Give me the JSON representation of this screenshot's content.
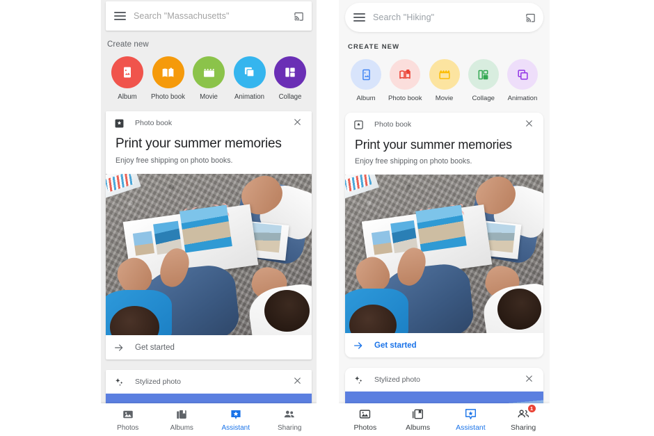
{
  "panels": {
    "old": {
      "search": {
        "placeholder": "Search \"Massachusetts\"",
        "menu_icon": "hamburger-menu-icon",
        "cast_icon": "cast-icon"
      },
      "create_new": {
        "title": "Create new",
        "items": [
          {
            "label": "Album",
            "icon": "album-icon",
            "circle": "#F0544C",
            "glyph": "#ffffff"
          },
          {
            "label": "Photo book",
            "icon": "photo-book-icon",
            "circle": "#F59A0B",
            "glyph": "#ffffff"
          },
          {
            "label": "Movie",
            "icon": "movie-icon",
            "circle": "#8BC34A",
            "glyph": "#ffffff"
          },
          {
            "label": "Animation",
            "icon": "animation-icon",
            "circle": "#35B5EE",
            "glyph": "#ffffff"
          },
          {
            "label": "Collage",
            "icon": "collage-icon",
            "circle": "#6A2FB5",
            "glyph": "#ffffff"
          }
        ]
      },
      "cards": [
        {
          "source_icon": "assistant-card-icon",
          "source_label": "Photo book",
          "close_icon": "close-icon",
          "title": "Print your summer memories",
          "subtitle": "Enjoy free shipping on photo books.",
          "cta_icon": "arrow-right-icon",
          "cta_label": "Get started"
        },
        {
          "source_icon": "stylized-photo-icon",
          "source_label": "Stylized photo",
          "close_icon": "close-icon"
        }
      ],
      "bottom_nav": [
        {
          "label": "Photos",
          "icon": "photos-icon",
          "active": false,
          "badge": ""
        },
        {
          "label": "Albums",
          "icon": "albums-icon",
          "active": false,
          "badge": ""
        },
        {
          "label": "Assistant",
          "icon": "assistant-icon",
          "active": true,
          "badge": ""
        },
        {
          "label": "Sharing",
          "icon": "sharing-icon",
          "active": false,
          "badge": ""
        }
      ]
    },
    "new": {
      "search": {
        "placeholder": "Search \"Hiking\"",
        "menu_icon": "hamburger-menu-icon",
        "cast_icon": "cast-icon"
      },
      "create_new": {
        "title": "CREATE NEW",
        "items": [
          {
            "label": "Album",
            "icon": "album-icon",
            "circle": "#D8E4FB",
            "glyph": "#4285F4"
          },
          {
            "label": "Photo book",
            "icon": "photo-book-icon",
            "circle": "#FBDEDC",
            "glyph": "#EA4335"
          },
          {
            "label": "Movie",
            "icon": "movie-icon",
            "circle": "#FCE4A0",
            "glyph": "#FBBC04"
          },
          {
            "label": "Collage",
            "icon": "collage-icon",
            "circle": "#D8EDDF",
            "glyph": "#34A853"
          },
          {
            "label": "Animation",
            "icon": "animation-icon",
            "circle": "#EEDEFA",
            "glyph": "#9334E6"
          }
        ]
      },
      "cards": [
        {
          "source_icon": "assistant-card-icon",
          "source_label": "Photo book",
          "close_icon": "close-icon",
          "title": "Print your summer memories",
          "subtitle": "Enjoy free shipping on photo books.",
          "cta_icon": "arrow-right-icon",
          "cta_label": "Get started"
        },
        {
          "source_icon": "stylized-photo-icon",
          "source_label": "Stylized photo",
          "close_icon": "close-icon"
        }
      ],
      "bottom_nav": [
        {
          "label": "Photos",
          "icon": "photos-icon",
          "active": false,
          "badge": ""
        },
        {
          "label": "Albums",
          "icon": "albums-icon",
          "active": false,
          "badge": ""
        },
        {
          "label": "Assistant",
          "icon": "assistant-icon",
          "active": true,
          "badge": ""
        },
        {
          "label": "Sharing",
          "icon": "sharing-icon",
          "active": false,
          "badge": "1"
        }
      ]
    }
  },
  "colors": {
    "accent_blue": "#1a73e8",
    "badge_red": "#ea4335",
    "old_panel_bg": "#eeeeee",
    "new_panel_bg": "#f7f7f7",
    "card_bg": "#ffffff",
    "text_primary": "#202124",
    "text_secondary": "#5f6368"
  }
}
